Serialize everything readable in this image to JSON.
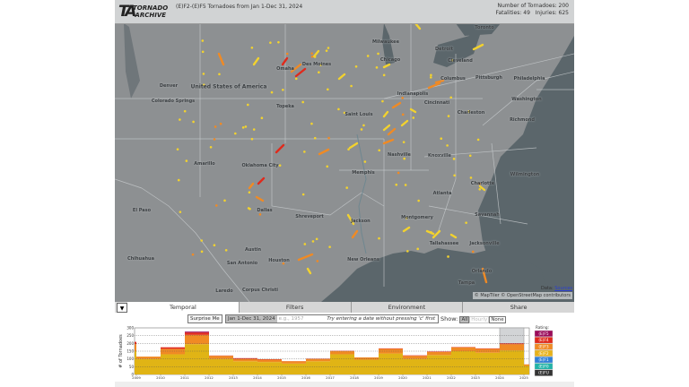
{
  "header": {
    "logo_letters": "TA",
    "logo_word1": "TORNADO",
    "logo_word2": "ARCHIVE",
    "title": "(E)F2-(E)F5 Tornadoes from Jan 1-Dec 31, 2024",
    "num_tornadoes": "Number of Tornadoes: 200",
    "fatalities": "Fatalities: 49",
    "injuries": "Injuries: 625"
  },
  "map": {
    "country_label": "United States of America",
    "cities": [
      "Denver",
      "Colorado Springs",
      "Omaha",
      "Des Moines",
      "Topeka",
      "Milwaukee",
      "Chicago",
      "Detroit",
      "Toronto",
      "Cleveland",
      "Indianapolis",
      "Columbus",
      "Pittsburgh",
      "Philadelphia",
      "Washington",
      "Richmond",
      "Cincinnati",
      "Charleston",
      "Saint Louis",
      "Nashville",
      "Knoxville",
      "Memphis",
      "Amarillo",
      "Oklahoma City",
      "Dallas",
      "Atlanta",
      "Charlotte",
      "Wilmington",
      "Savannah",
      "Montgomery",
      "Jackson",
      "Shreveport",
      "Tallahassee",
      "Jacksonville",
      "Houston",
      "Austin",
      "San Antonio",
      "New Orleans",
      "El Paso",
      "Chihuahua",
      "Tampa",
      "Orlando",
      "Laredo",
      "Corpus Christi"
    ],
    "attribution_data": "Data:",
    "attribution_sources": "Sources",
    "attribution_copyright": "© MapTiler © OpenStreetMap contributors",
    "colors": {
      "land": "#8d9092",
      "water": "#5b666b",
      "border": "#c9cdd0",
      "ef2": "#f2d22e",
      "ef3": "#f08a24",
      "ef4": "#e02a1c",
      "ef5": "#9b0b5a"
    }
  },
  "tabs": {
    "toggle": "▼",
    "items": [
      "Temporal",
      "Filters",
      "Environment",
      "Share"
    ],
    "active": "Temporal"
  },
  "controls": {
    "surprise": "Surprise Me",
    "date_value": "Jan 1-Dec 31, 2024",
    "date_placeholder": "e.g., 1957",
    "hint": "Try entering a date without pressing 'c' first",
    "show_label": "Show:",
    "show_all": "All",
    "show_hourly": "Hourly",
    "show_none": "None"
  },
  "chart_data": {
    "type": "bar",
    "stacked": true,
    "ylabel": "# of Tornadoes",
    "ylim": [
      0,
      300
    ],
    "yticks": [
      0,
      50,
      100,
      150,
      200,
      250,
      300
    ],
    "grid": true,
    "xtick_labels": [
      "2009",
      "2010",
      "2011",
      "2012",
      "2013",
      "2014",
      "2015",
      "2016",
      "2017",
      "2018",
      "2019",
      "2020",
      "2021",
      "2022",
      "2023",
      "2024",
      "2025"
    ],
    "categories": [
      "2008",
      "2009",
      "2010",
      "2011",
      "2012",
      "2013",
      "2014",
      "2015",
      "2016",
      "2017",
      "2018",
      "2019",
      "2020",
      "2021",
      "2022",
      "2023",
      "2024",
      "2025"
    ],
    "highlighted": "2024",
    "legend_title": "Rating:",
    "legend_placement": "right",
    "legend": [
      {
        "label": "(E)F5",
        "color": "#9b0b5a"
      },
      {
        "label": "(E)F4",
        "color": "#e02a1c"
      },
      {
        "label": "(E)F3",
        "color": "#f08a24"
      },
      {
        "label": "(E)F2",
        "color": "#e8b21a"
      },
      {
        "label": "(E)F1",
        "color": "#2f7fd8"
      },
      {
        "label": "(E)F0",
        "color": "#22b3a8"
      },
      {
        "label": "(E)FU",
        "color": "#333333"
      }
    ],
    "series": [
      {
        "name": "(E)F2",
        "color": "#e0b415",
        "values": [
          150,
          100,
          130,
          195,
          100,
          85,
          80,
          70,
          85,
          130,
          95,
          135,
          100,
          125,
          150,
          140,
          155,
          55
        ]
      },
      {
        "name": "(E)F3",
        "color": "#f08a24",
        "values": [
          45,
          15,
          35,
          60,
          20,
          15,
          15,
          15,
          15,
          20,
          15,
          30,
          20,
          20,
          25,
          25,
          40,
          10
        ]
      },
      {
        "name": "(E)F4",
        "color": "#e02a1c",
        "values": [
          15,
          0,
          10,
          15,
          2,
          5,
          3,
          1,
          2,
          2,
          0,
          3,
          3,
          3,
          2,
          3,
          5,
          0
        ]
      },
      {
        "name": "(E)F5",
        "color": "#9b0b5a",
        "values": [
          0,
          0,
          0,
          6,
          0,
          0,
          0,
          0,
          0,
          0,
          0,
          0,
          0,
          0,
          0,
          0,
          0,
          0
        ]
      }
    ]
  }
}
